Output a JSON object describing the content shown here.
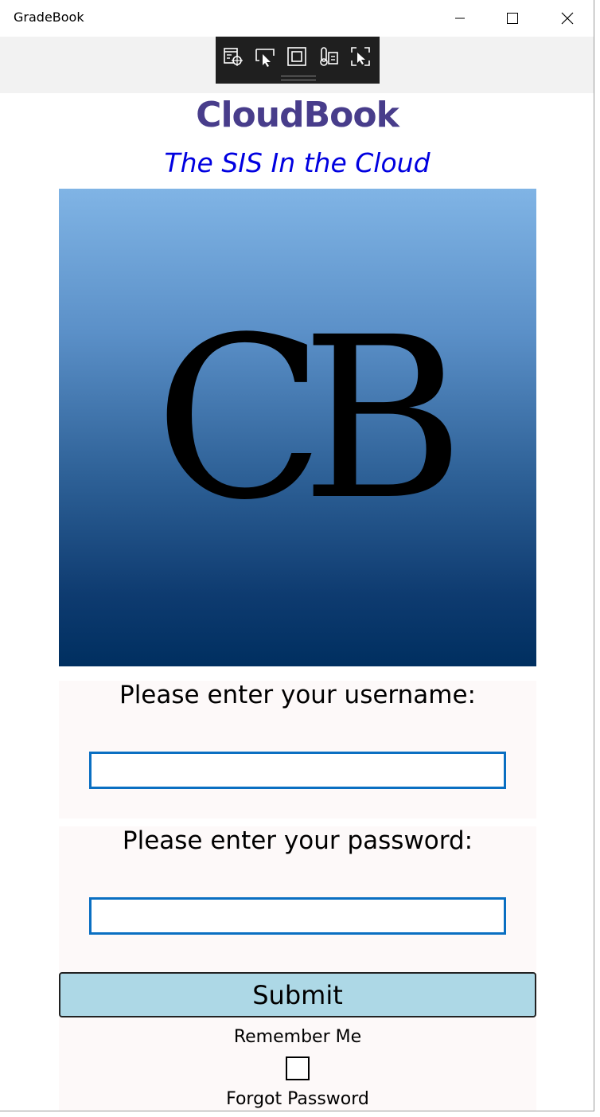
{
  "window": {
    "title": "GradeBook",
    "minimize_icon": "minimize-icon",
    "maximize_icon": "maximize-icon",
    "close_icon": "close-icon"
  },
  "devtools": {
    "icons": [
      "select-element-icon",
      "pointer-select-icon",
      "display-layout-adorners-icon",
      "track-focus-icon",
      "ui-selection-icon"
    ]
  },
  "app": {
    "title": "CloudBook",
    "subtitle": "The SIS In the Cloud",
    "title_color": "#483d8b",
    "subtitle_color": "#0000e0"
  },
  "logo": {
    "text": "CB",
    "gradient_top": "#80b4e5",
    "gradient_bottom": "#002f60"
  },
  "username": {
    "label": "Please enter your username:",
    "value": "",
    "placeholder": ""
  },
  "password": {
    "label": "Please enter your password:",
    "value": "",
    "placeholder": ""
  },
  "submit": {
    "label": "Submit",
    "color": "#add8e6"
  },
  "remember": {
    "label": "Remember Me",
    "checked": false
  },
  "forgot": {
    "label": "Forgot Password"
  }
}
